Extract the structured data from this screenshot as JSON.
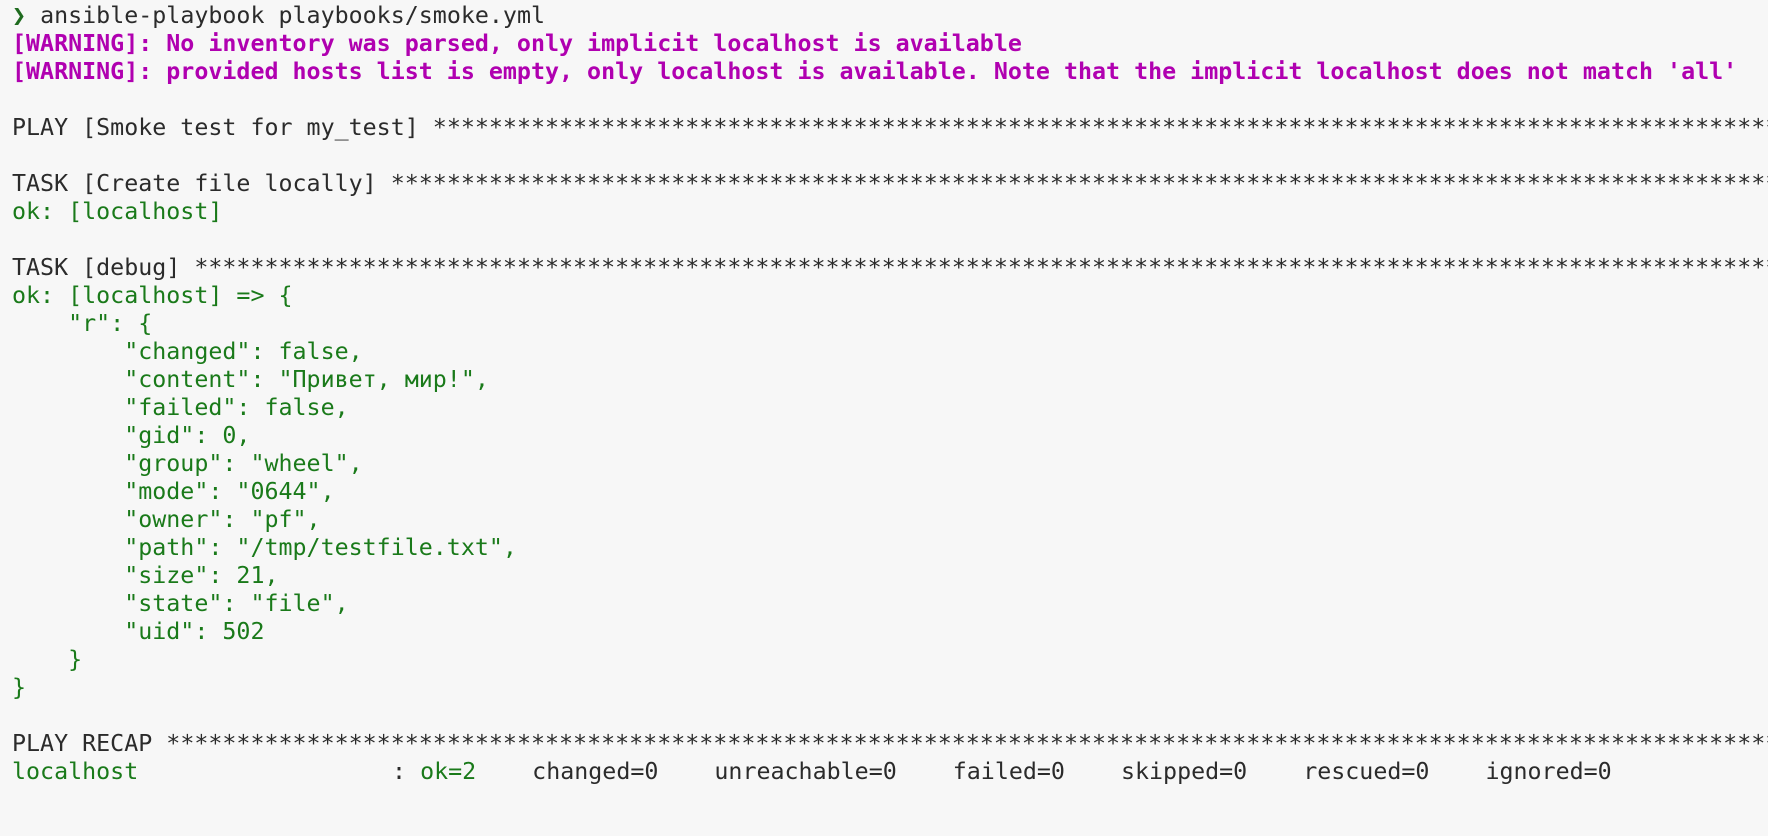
{
  "prompt": {
    "symbol": "❯",
    "command": "ansible-playbook playbooks/smoke.yml"
  },
  "warnings": [
    "[WARNING]: No inventory was parsed, only implicit localhost is available",
    "[WARNING]: provided hosts list is empty, only localhost is available. Note that the implicit localhost does not match 'all'"
  ],
  "play": {
    "header": "PLAY [Smoke test for my_test]"
  },
  "task_create": {
    "header": "TASK [Create file locally]",
    "result": "ok: [localhost]"
  },
  "task_debug": {
    "header": "TASK [debug]",
    "result_lines": [
      "ok: [localhost] => {",
      "    \"r\": {",
      "        \"changed\": false,",
      "        \"content\": \"Привет, мир!\",",
      "        \"failed\": false,",
      "        \"gid\": 0,",
      "        \"group\": \"wheel\",",
      "        \"mode\": \"0644\",",
      "        \"owner\": \"pf\",",
      "        \"path\": \"/tmp/testfile.txt\",",
      "        \"size\": 21,",
      "        \"state\": \"file\",",
      "        \"uid\": 502",
      "    }",
      "}"
    ]
  },
  "recap": {
    "header": "PLAY RECAP",
    "host": "localhost",
    "colon": ": ",
    "ok": "ok=2",
    "changed": "changed=0",
    "unreachable": "unreachable=0",
    "failed": "failed=0",
    "skipped": "skipped=0",
    "rescued": "rescued=0",
    "ignored": "ignored=0"
  },
  "stars": "*****************************************************************************************************************************************************************"
}
